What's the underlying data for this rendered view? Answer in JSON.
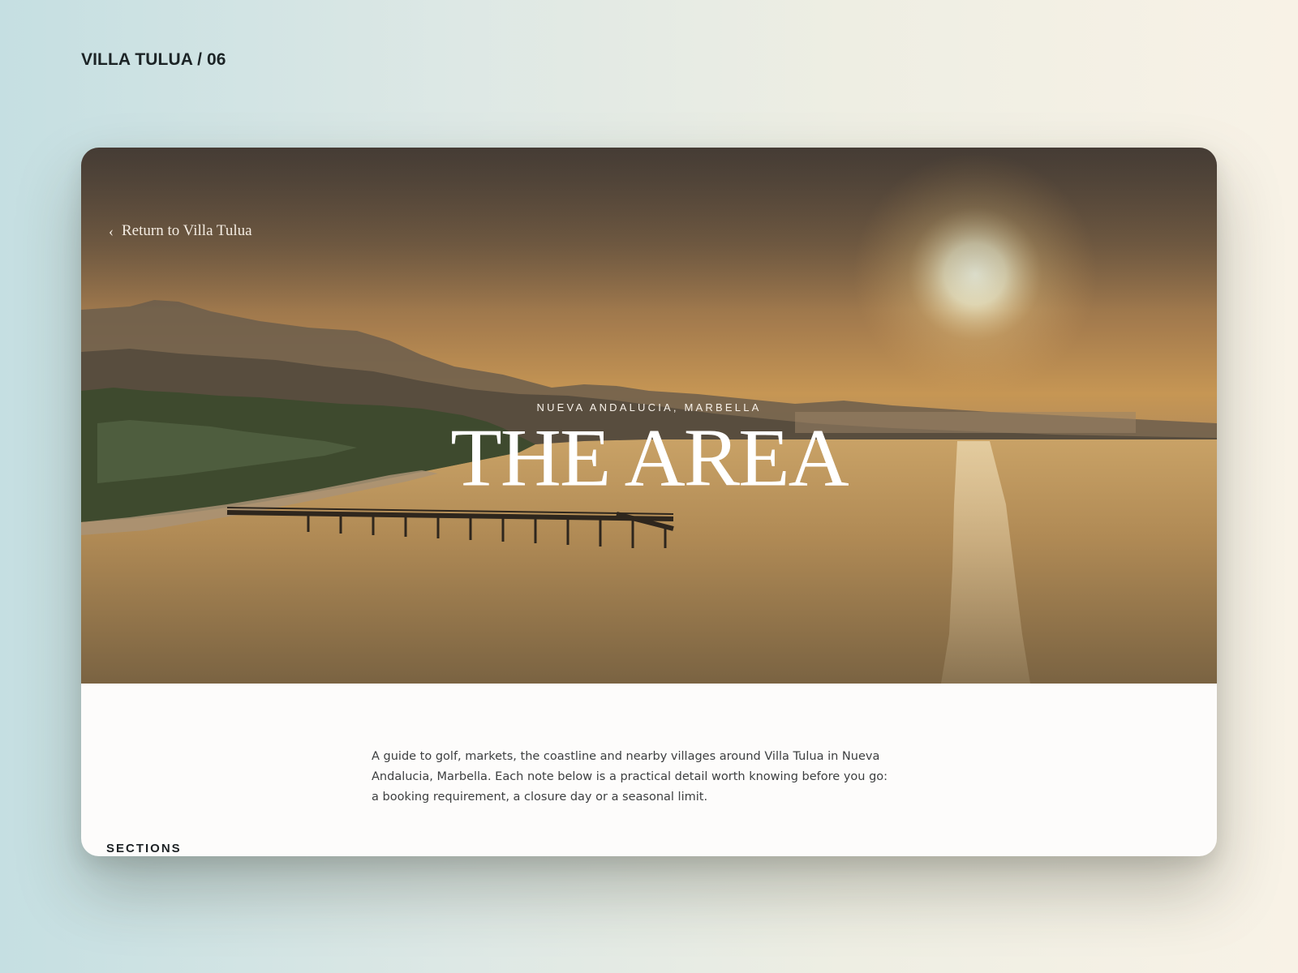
{
  "slide": {
    "label": "VILLA TULUA / 06"
  },
  "hero": {
    "back_link": "Return to Villa Tulua",
    "subtitle": "NUEVA ANDALUCIA, MARBELLA",
    "title": "THE AREA"
  },
  "content": {
    "intro": "A guide to golf, markets, the coastline and nearby villages around Villa Tulua in Nueva Andalucia, Marbella. Each note below is a practical detail worth knowing before you go: a booking requirement, a closure day or a seasonal limit.",
    "sections_heading": "SECTIONS"
  },
  "icons": {
    "back": "chevron-left-icon"
  },
  "colors": {
    "hero_text": "#ffffff",
    "body_text": "#3d3f40",
    "page_bg": "#fdfcfb"
  }
}
